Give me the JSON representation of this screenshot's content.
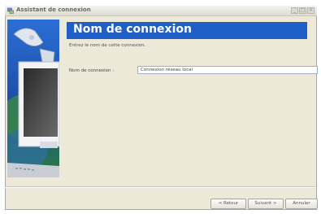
{
  "window": {
    "title": "Assistant de connexion",
    "buttons": [
      "_",
      "□",
      "×"
    ]
  },
  "header": {
    "title": "Nom de connexion",
    "subtitle": "Entrez le nom de cette connexion."
  },
  "form": {
    "label": "Nom de connexion :",
    "value": "Connexion réseau local"
  },
  "footer": {
    "back_label": "< Retour",
    "next_label": "Suivant >",
    "cancel_label": "Annuler"
  },
  "colors": {
    "header_band": "#1f5fc7",
    "dialog_bg": "#ece9d8"
  },
  "icons": {
    "title": "network-wizard-icon",
    "side_image": "computer-monitor-network-illustration"
  }
}
